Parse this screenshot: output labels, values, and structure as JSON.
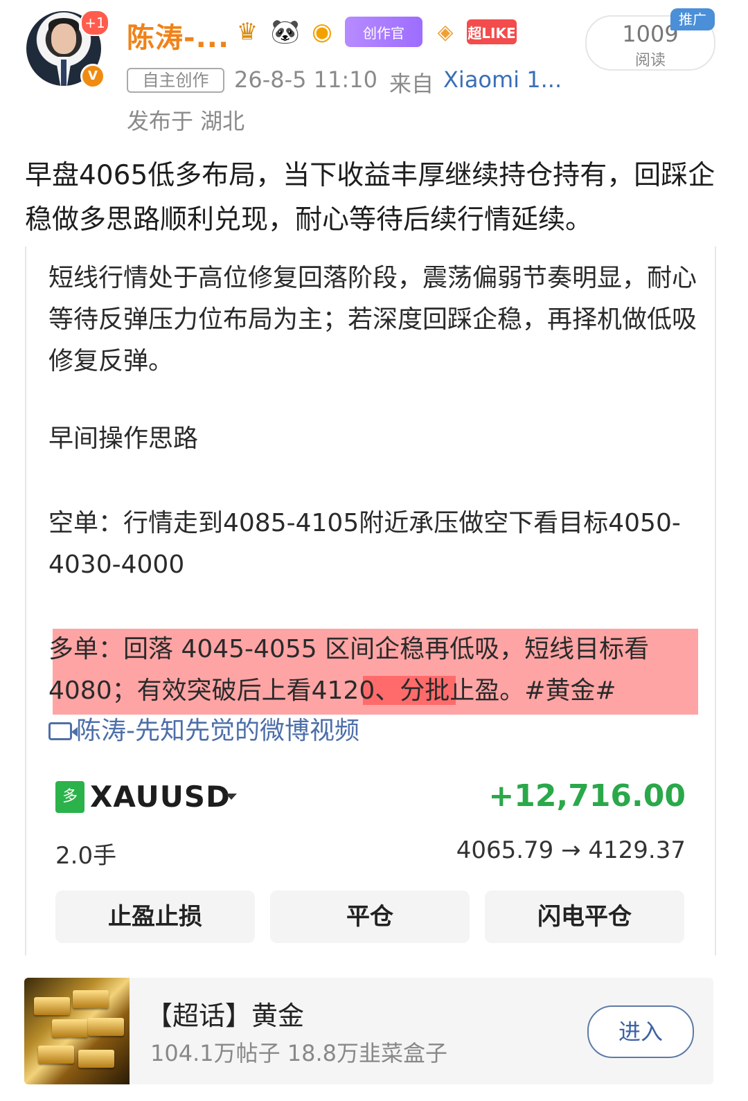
{
  "header": {
    "username": "陈涛-...",
    "avatar_badge": "+1",
    "verified_mark": "V",
    "badges": [
      "crown-icon",
      "panda-icon",
      "fish-icon",
      "创作官",
      "gem-icon",
      "超LIKE"
    ],
    "original_tag": "自主创作",
    "timestamp": "26-8-5 11:10",
    "from_label": "来自",
    "device": "Xiaomi 1...",
    "location": "发布于 湖北",
    "read_count": "1009",
    "read_label": "阅读",
    "promo_label": "推广"
  },
  "post": {
    "text": "早盘4065低多布局，当下收益丰厚继续持仓持有，回踩企稳做多思路顺利兑现，耐心等待后续行情延续。"
  },
  "card": {
    "p1": "短线行情处于高位修复回落阶段，震荡偏弱节奏明显，耐心等待反弹压力位布局为主；若深度回踩企稳，再择机做低吸修复反弹。",
    "p2": "早间操作思路",
    "p3": "空单：行情走到4085-4105附近承压做空下看目标4050-4030-4000",
    "p4": "多单：回落 4045-4055 区间企稳再低吸，短线目标看4080；有效突破后上看4120、分批止盈。#黄金#",
    "video_link": "陈涛-先知先觉的微博视频",
    "trade": {
      "direction": "多",
      "symbol": "XAUUSD",
      "pnl": "+12,716.00",
      "lots": "2.0手",
      "prices": "4065.79 → 4129.37",
      "buttons": [
        "止盈止损",
        "平仓",
        "闪电平仓"
      ]
    }
  },
  "topic": {
    "title": "【超话】黄金",
    "stats": "104.1万帖子 18.8万韭菜盒子",
    "enter_label": "进入"
  },
  "colors": {
    "username": "#f08218",
    "link": "#4d6fa9",
    "profit": "#2aa84a",
    "highlight": "#ff5a5a"
  }
}
